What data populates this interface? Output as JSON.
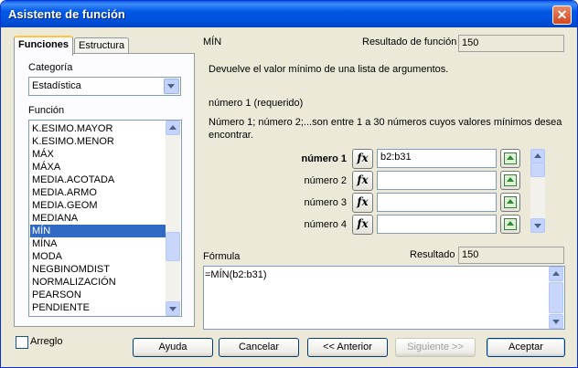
{
  "window": {
    "title": "Asistente de función",
    "close_symbol": "✕"
  },
  "tabs": [
    {
      "label": "Funciones"
    },
    {
      "label": "Estructura"
    }
  ],
  "category": {
    "label": "Categoría",
    "value": "Estadística"
  },
  "functions": {
    "label": "Función",
    "items": [
      "K.ESIMO.MAYOR",
      "K.ESIMO.MENOR",
      "MÁX",
      "MÁXA",
      "MEDIA.ACOTADA",
      "MEDIA.ARMO",
      "MEDIA.GEOM",
      "MEDIANA",
      "MÍN",
      "MÍNA",
      "MODA",
      "NEGBINOMDIST",
      "NORMALIZACIÓN",
      "PEARSON",
      "PENDIENTE"
    ],
    "selected": "MÍN"
  },
  "function_info": {
    "name": "MÍN",
    "result_label": "Resultado de función",
    "result_value": "150",
    "description": "Devuelve el valor mínimo de una lista de argumentos.",
    "arg_title": "número 1 (requerido)",
    "arg_desc_line1": "Número 1; número 2;...son entre 1 a 30 números cuyos valores mínimos desea",
    "arg_desc_line2": "encontrar."
  },
  "args": [
    {
      "label": "número 1",
      "value": "b2:b31",
      "fx": "fx"
    },
    {
      "label": "número 2",
      "value": "",
      "fx": "fx"
    },
    {
      "label": "número 3",
      "value": "",
      "fx": "fx"
    },
    {
      "label": "número 4",
      "value": "",
      "fx": "fx"
    }
  ],
  "formula": {
    "label": "Fórmula",
    "result_label": "Resultado",
    "result_value": "150",
    "text": "=MÍN(b2:b31)"
  },
  "array_checkbox": {
    "label": "Arreglo",
    "checked": false
  },
  "buttons": {
    "help": "Ayuda",
    "cancel": "Cancelar",
    "back": "<< Anterior",
    "next": "Siguiente >>",
    "ok": "Aceptar"
  }
}
